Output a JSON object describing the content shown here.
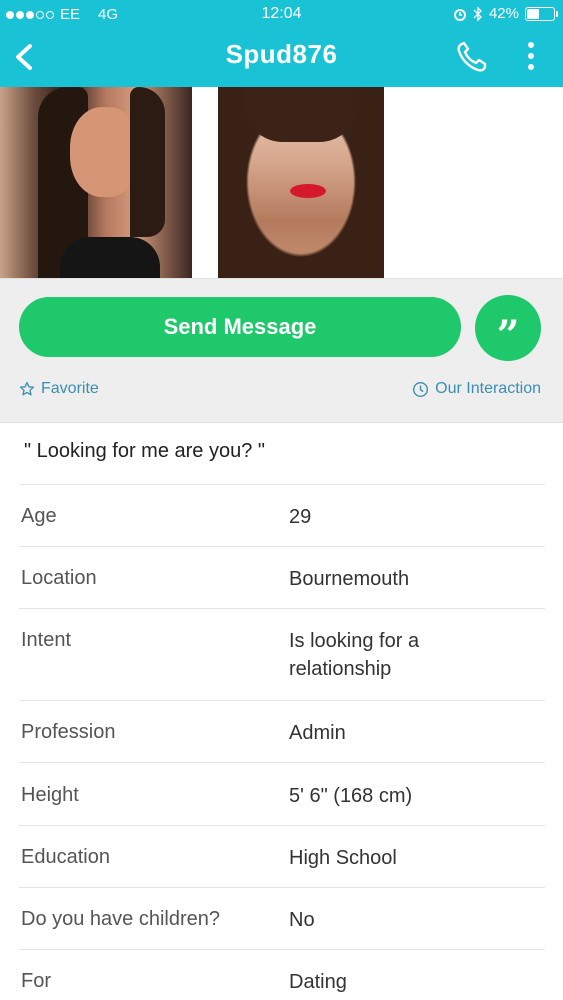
{
  "status_bar": {
    "carrier": "EE",
    "network": "4G",
    "time": "12:04",
    "battery": "42%",
    "battery_level": 0.42
  },
  "nav": {
    "title": "Spud876",
    "back_icon": "chevron-left-icon",
    "call_icon": "phone-icon",
    "more_icon": "more-vertical-icon"
  },
  "actions": {
    "send_message": "Send Message",
    "quote_symbol": "”",
    "favorite": "Favorite",
    "our_interaction": "Our Interaction"
  },
  "profile": {
    "headline": "\" Looking for me are you? \"",
    "rows": [
      {
        "label": "Age",
        "value": "29"
      },
      {
        "label": "Location",
        "value": "Bournemouth"
      },
      {
        "label": "Intent",
        "value": "Is looking for a relationship"
      },
      {
        "label": "Profession",
        "value": "Admin"
      },
      {
        "label": "Height",
        "value": "5' 6\" (168 cm)"
      },
      {
        "label": "Education",
        "value": "High School"
      },
      {
        "label": "Do you have children?",
        "value": "No"
      },
      {
        "label": "For",
        "value": "Dating"
      }
    ]
  },
  "colors": {
    "header": "#19c3d5",
    "accent_green": "#1ec86b",
    "link_blue": "#3a8fb0"
  }
}
